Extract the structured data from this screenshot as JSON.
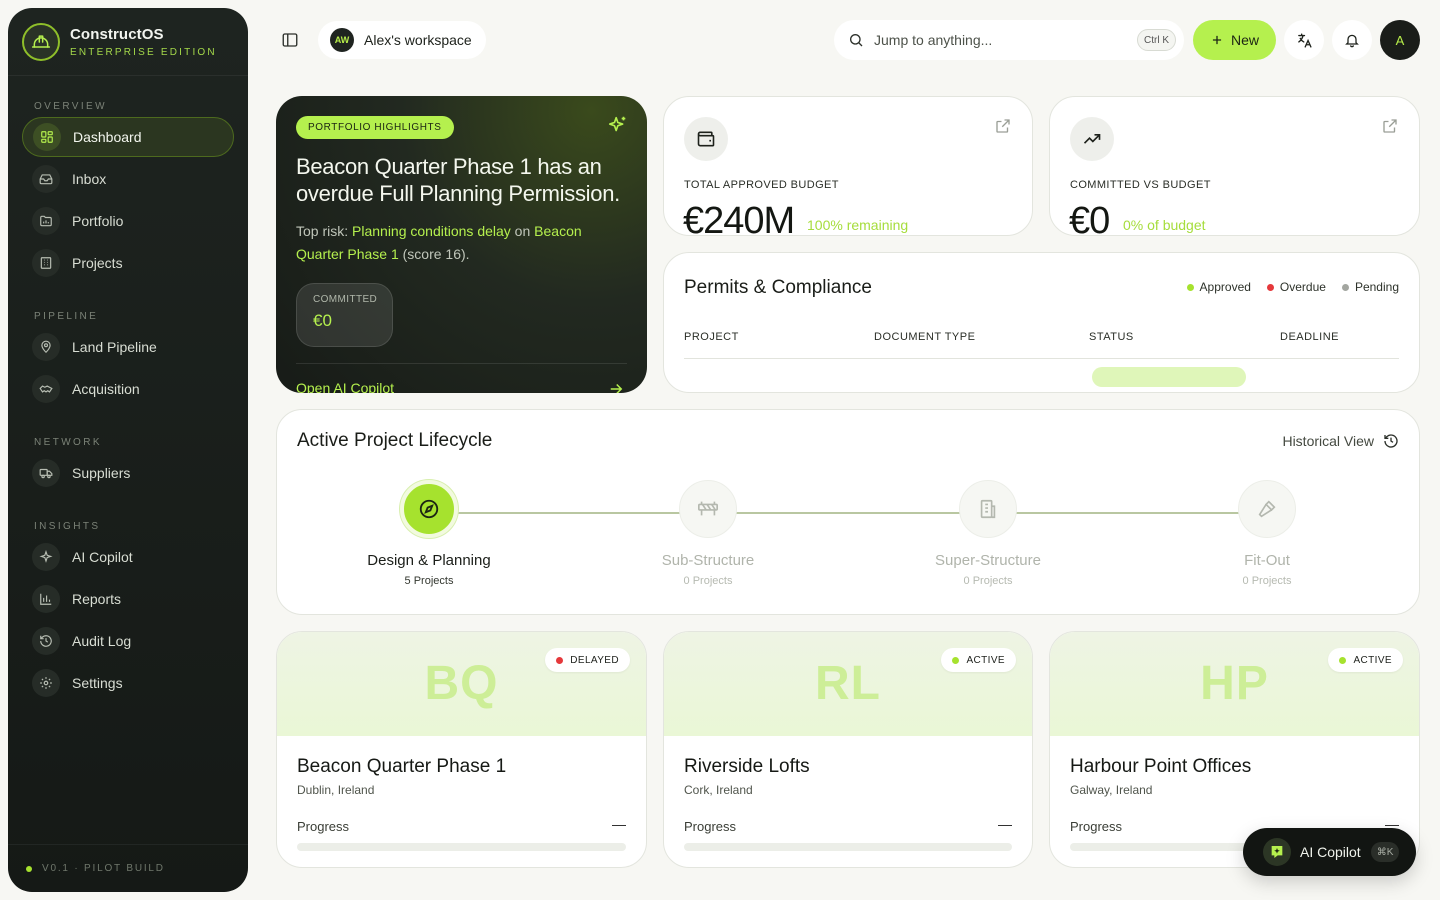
{
  "sidebar": {
    "brand_name": "ConstructOS",
    "brand_sub": "ENTERPRISE EDITION",
    "sections": {
      "overview": "OVERVIEW",
      "pipeline": "PIPELINE",
      "network": "NETWORK",
      "insights": "INSIGHTS"
    },
    "items": [
      {
        "label": "Dashboard",
        "icon": "dashboard-icon",
        "active": true
      },
      {
        "label": "Inbox",
        "icon": "inbox-icon"
      },
      {
        "label": "Portfolio",
        "icon": "folder-icon"
      },
      {
        "label": "Projects",
        "icon": "building-icon"
      },
      {
        "label": "Land Pipeline",
        "icon": "map-pin-icon"
      },
      {
        "label": "Acquisition",
        "icon": "handshake-icon"
      },
      {
        "label": "Suppliers",
        "icon": "truck-icon"
      },
      {
        "label": "AI Copilot",
        "icon": "sparkles-icon"
      },
      {
        "label": "Reports",
        "icon": "bar-chart-icon"
      },
      {
        "label": "Audit Log",
        "icon": "history-icon"
      },
      {
        "label": "Settings",
        "icon": "gear-icon"
      }
    ],
    "footer": "V0.1 · PILOT BUILD"
  },
  "topbar": {
    "workspace_initials": "AW",
    "workspace_name": "Alex's workspace",
    "search_placeholder": "Jump to anything...",
    "search_shortcut": "Ctrl K",
    "new_label": "New",
    "user_initial": "A"
  },
  "hero": {
    "badge": "PORTFOLIO HIGHLIGHTS",
    "title": "Beacon Quarter Phase 1 has an overdue Full Planning Permission.",
    "risk_prefix": "Top risk: ",
    "risk_name": "Planning conditions delay",
    "risk_on": " on ",
    "risk_project": "Beacon Quarter Phase 1",
    "risk_score": " (score 16).",
    "committed_label": "COMMITTED",
    "committed_value": "€0",
    "link": "Open AI Copilot"
  },
  "stats": [
    {
      "label": "TOTAL APPROVED BUDGET",
      "value": "€240M",
      "sub": "100% remaining",
      "icon": "wallet-icon"
    },
    {
      "label": "COMMITTED VS BUDGET",
      "value": "€0",
      "sub": "0% of budget",
      "icon": "trending-up-icon"
    }
  ],
  "permits": {
    "title": "Permits & Compliance",
    "legend": [
      {
        "label": "Approved",
        "color": "#a6e22e"
      },
      {
        "label": "Overdue",
        "color": "#e5383b"
      },
      {
        "label": "Pending",
        "color": "#a3a6a0"
      }
    ],
    "columns": [
      "PROJECT",
      "DOCUMENT TYPE",
      "STATUS",
      "DEADLINE"
    ]
  },
  "lifecycle": {
    "title": "Active Project Lifecycle",
    "historical": "Historical View",
    "stages": [
      {
        "name": "Design & Planning",
        "count": "5 Projects",
        "icon": "compass-icon",
        "active": true
      },
      {
        "name": "Sub-Structure",
        "count": "0 Projects",
        "icon": "barrier-icon"
      },
      {
        "name": "Super-Structure",
        "count": "0 Projects",
        "icon": "building-icon"
      },
      {
        "name": "Fit-Out",
        "count": "0 Projects",
        "icon": "hammer-icon"
      }
    ]
  },
  "projects": [
    {
      "initials": "BQ",
      "status": "DELAYED",
      "status_color": "#e5383b",
      "name": "Beacon Quarter Phase 1",
      "location": "Dublin, Ireland",
      "progress_label": "Progress",
      "progress_value": "—"
    },
    {
      "initials": "RL",
      "status": "ACTIVE",
      "status_color": "#a6e22e",
      "name": "Riverside Lofts",
      "location": "Cork, Ireland",
      "progress_label": "Progress",
      "progress_value": "—"
    },
    {
      "initials": "HP",
      "status": "ACTIVE",
      "status_color": "#a6e22e",
      "name": "Harbour Point Offices",
      "location": "Galway, Ireland",
      "progress_label": "Progress",
      "progress_value": "—"
    }
  ],
  "copilot_fab": {
    "label": "AI Copilot",
    "shortcut": "⌘K"
  },
  "colors": {
    "accent": "#b5f04e",
    "sidebar": "#1a1f1b",
    "overdue": "#e5383b"
  }
}
